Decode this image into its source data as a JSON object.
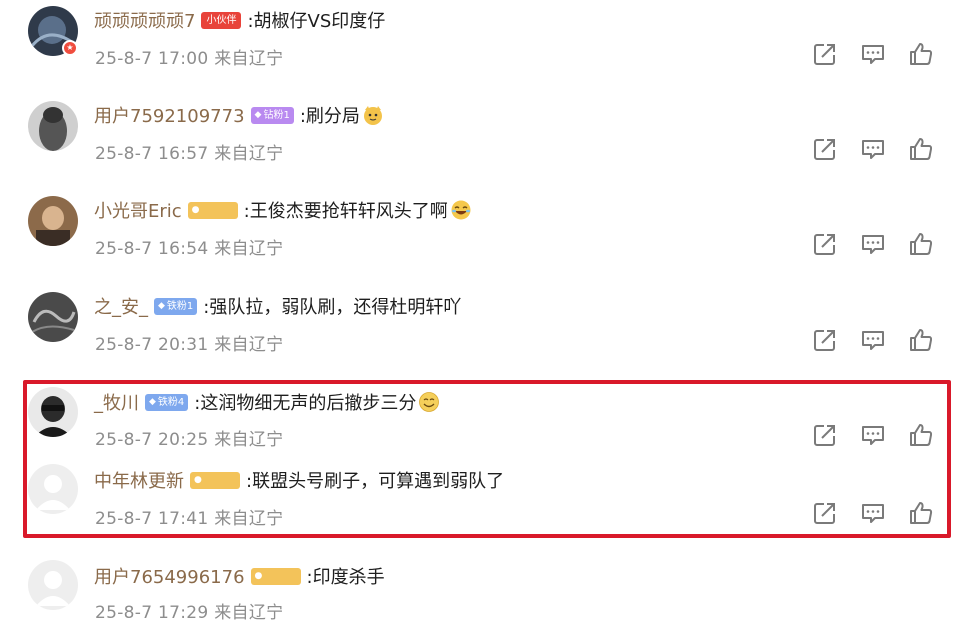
{
  "comments": [
    {
      "username": "顽顽顽顽顽7",
      "badge": "小伙伴",
      "badge_style": "red",
      "text": ":胡椒仔VS印度仔",
      "emoji": "",
      "time": "25-8-7 17:00",
      "location": "来自辽宁"
    },
    {
      "username": "用户7592109773",
      "badge": "钻粉1",
      "badge_style": "purple",
      "text": ":刷分局",
      "emoji": "cat-face-emoji",
      "time": "25-8-7 16:57",
      "location": "来自辽宁"
    },
    {
      "username": "小光哥Eric",
      "badge": "",
      "badge_style": "gold",
      "text": ":王俊杰要抢轩轩风头了啊",
      "emoji": "laughing-emoji",
      "time": "25-8-7 16:54",
      "location": "来自辽宁"
    },
    {
      "username": "之_安_",
      "badge": "铁粉1",
      "badge_style": "blue",
      "text": ":强队拉，弱队刷，还得杜明轩吖",
      "emoji": "",
      "time": "25-8-7 20:31",
      "location": "来自辽宁"
    },
    {
      "username": "_牧川",
      "badge": "铁粉4",
      "badge_style": "blue",
      "text": ":这润物细无声的后撤步三分",
      "emoji": "smile-emoji",
      "time": "25-8-7 20:25",
      "location": "来自辽宁"
    },
    {
      "username": "中年林更新",
      "badge": "",
      "badge_style": "gold",
      "text": ":联盟头号刷子，可算遇到弱队了",
      "emoji": "",
      "time": "25-8-7 17:41",
      "location": "来自辽宁"
    },
    {
      "username": "用户7654996176",
      "badge": "",
      "badge_style": "gold",
      "text": ":印度杀手",
      "emoji": "",
      "time": "25-8-7 17:29",
      "location": "来自辽宁"
    }
  ],
  "colors": {
    "username": "#8a6a4a",
    "meta": "#8d8d8d",
    "highlight_border": "#d9192a",
    "icon": "#7a7a7a"
  },
  "icons": {
    "share": "share-icon",
    "reply": "comment-icon",
    "like": "thumbs-up-icon"
  }
}
